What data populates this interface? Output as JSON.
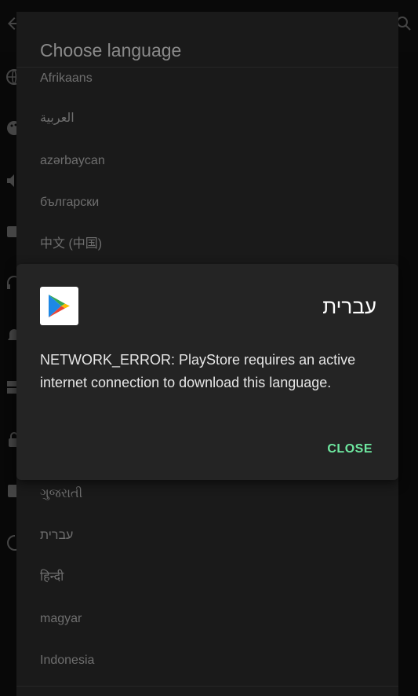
{
  "language_dialog": {
    "title": "Choose language",
    "languages": [
      "Afrikaans",
      "العربية",
      "azərbaycan",
      "български",
      "中文 (中国)",
      "ગુજરાતી",
      "עברית",
      "हिन्दी",
      "magyar",
      "Indonesia"
    ]
  },
  "alert": {
    "title": "עברית",
    "message": "NETWORK_ERROR: PlayStore requires an active internet connection to download this language.",
    "close_label": "CLOSE",
    "app_icon": "play-store-icon"
  },
  "colors": {
    "accent": "#6ee8a0",
    "dialog_bg": "#242424",
    "list_bg": "#1a1a1a"
  }
}
